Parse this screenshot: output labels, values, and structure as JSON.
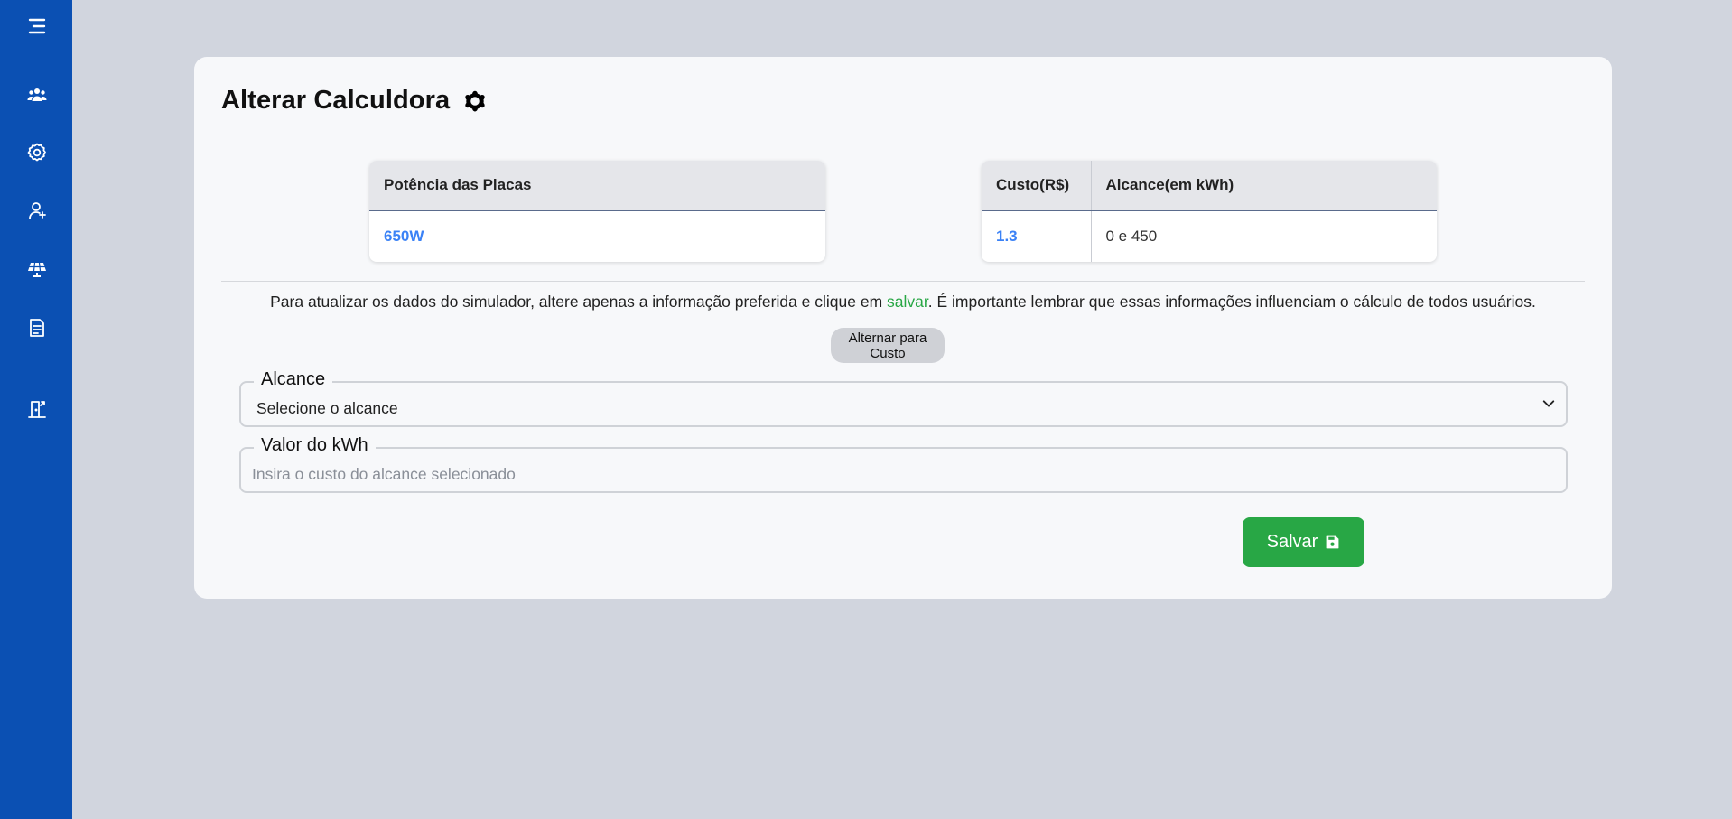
{
  "sidebar": {
    "items": [
      {
        "icon": "menu-icon"
      },
      {
        "icon": "users-icon"
      },
      {
        "icon": "settings-icon"
      },
      {
        "icon": "add-user-icon"
      },
      {
        "icon": "solar-panel-icon"
      },
      {
        "icon": "document-icon"
      },
      {
        "icon": "logout-icon"
      }
    ],
    "color": "#0b50b3"
  },
  "page": {
    "title": "Alterar Calculdora",
    "title_icon": "gear-icon"
  },
  "power_table": {
    "header": "Potência das Placas",
    "value": "650W"
  },
  "cost_table": {
    "headers": [
      "Custo(R$)",
      "Alcance(em kWh)"
    ],
    "row": [
      "1.3",
      "0 e 450"
    ]
  },
  "info": {
    "before": "Para atualizar os dados do simulador, altere apenas a informação preferida e clique em ",
    "link": "salvar",
    "after": ". É importante lembrar que essas informações influenciam o cálculo de todos usuários."
  },
  "toggle_button": "Alternar para Custo",
  "alcance_field": {
    "label": "Alcance",
    "selected": "Selecione o alcance"
  },
  "kwh_field": {
    "label": "Valor do kWh",
    "placeholder": "Insira o custo do alcance selecionado"
  },
  "save_button": {
    "label": "Salvar",
    "icon": "save-icon",
    "color": "#28a745"
  },
  "colors": {
    "accent_blue": "#3b82f6",
    "background": "#d1d5de"
  }
}
